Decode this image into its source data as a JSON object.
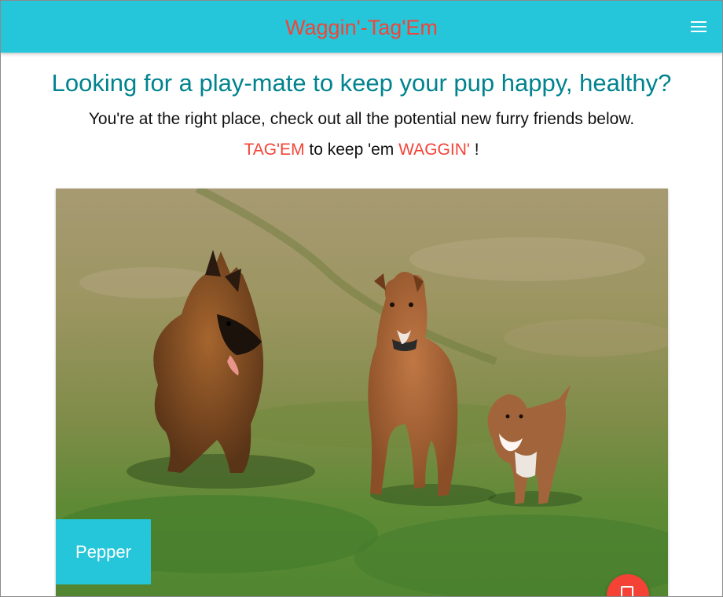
{
  "navbar": {
    "brand": "Waggin'-Tag'Em",
    "menu_icon": "hamburger-menu-icon",
    "brand_color": "#f44336",
    "bar_color": "#26c6da"
  },
  "intro": {
    "headline": "Looking for a play-mate to keep your pup happy, healthy?",
    "subline": "You're at the right place, check out all the potential new furry friends below.",
    "tag_part1": "TAG'EM",
    "tag_part2": " to keep 'em ",
    "tag_part3": "WAGGIN'",
    "tag_part4": " !"
  },
  "dog_card": {
    "name": "Pepper",
    "photo_subject": "three dogs running across a grassy field"
  },
  "fab": {
    "icon": "card-icon",
    "color": "#f44336"
  }
}
